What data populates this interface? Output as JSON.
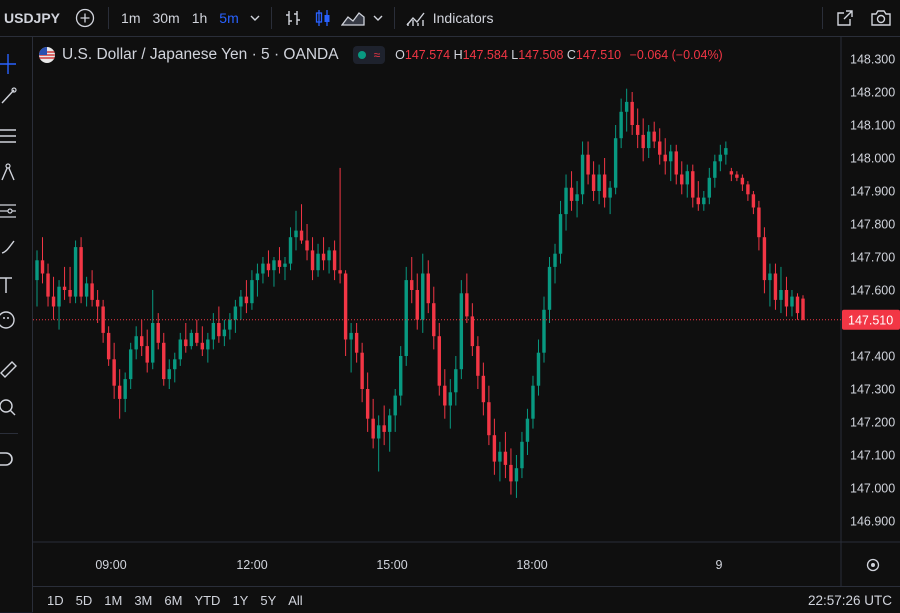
{
  "toolbar": {
    "symbol": "USDJPY",
    "timeframes": [
      "1m",
      "30m",
      "1h",
      "5m"
    ],
    "active_timeframe": "5m",
    "indicators_label": "Indicators"
  },
  "legend": {
    "title": "U.S. Dollar / Japanese Yen · 5 · OANDA",
    "open_label": "O",
    "open": "147.574",
    "high_label": "H",
    "high": "147.584",
    "low_label": "L",
    "low": "147.508",
    "close_label": "C",
    "close": "147.510",
    "change": "−0.064 (−0.04%)"
  },
  "bottom": {
    "ranges": [
      "1D",
      "5D",
      "1M",
      "3M",
      "6M",
      "YTD",
      "1Y",
      "5Y",
      "All"
    ],
    "clock": "22:57:26 UTC"
  },
  "colors": {
    "up": "#089981",
    "down": "#f23645",
    "accent": "#2962ff"
  },
  "chart_data": {
    "type": "candlestick",
    "y_ticks": [
      "148.300",
      "148.200",
      "148.100",
      "148.000",
      "147.900",
      "147.800",
      "147.700",
      "147.600",
      "147.510",
      "147.400",
      "147.300",
      "147.200",
      "147.100",
      "147.000",
      "146.900"
    ],
    "x_ticks": [
      "09:00",
      "12:00",
      "15:00",
      "18:00",
      "9"
    ],
    "ylim": [
      146.87,
      148.33
    ],
    "last_price": "147.510",
    "candles": [
      {
        "o": 147.63,
        "h": 147.72,
        "l": 147.55,
        "c": 147.69
      },
      {
        "o": 147.69,
        "h": 147.76,
        "l": 147.62,
        "c": 147.65
      },
      {
        "o": 147.65,
        "h": 147.68,
        "l": 147.55,
        "c": 147.58
      },
      {
        "o": 147.58,
        "h": 147.64,
        "l": 147.51,
        "c": 147.55
      },
      {
        "o": 147.55,
        "h": 147.63,
        "l": 147.48,
        "c": 147.61
      },
      {
        "o": 147.61,
        "h": 147.67,
        "l": 147.57,
        "c": 147.6
      },
      {
        "o": 147.6,
        "h": 147.67,
        "l": 147.56,
        "c": 147.58
      },
      {
        "o": 147.58,
        "h": 147.75,
        "l": 147.56,
        "c": 147.73
      },
      {
        "o": 147.73,
        "h": 147.76,
        "l": 147.56,
        "c": 147.58
      },
      {
        "o": 147.58,
        "h": 147.64,
        "l": 147.55,
        "c": 147.62
      },
      {
        "o": 147.62,
        "h": 147.66,
        "l": 147.55,
        "c": 147.57
      },
      {
        "o": 147.57,
        "h": 147.6,
        "l": 147.5,
        "c": 147.55
      },
      {
        "o": 147.55,
        "h": 147.57,
        "l": 147.44,
        "c": 147.47
      },
      {
        "o": 147.47,
        "h": 147.49,
        "l": 147.37,
        "c": 147.39
      },
      {
        "o": 147.39,
        "h": 147.44,
        "l": 147.27,
        "c": 147.31
      },
      {
        "o": 147.31,
        "h": 147.36,
        "l": 147.21,
        "c": 147.27
      },
      {
        "o": 147.27,
        "h": 147.35,
        "l": 147.23,
        "c": 147.33
      },
      {
        "o": 147.33,
        "h": 147.44,
        "l": 147.3,
        "c": 147.42
      },
      {
        "o": 147.42,
        "h": 147.49,
        "l": 147.39,
        "c": 147.46
      },
      {
        "o": 147.46,
        "h": 147.51,
        "l": 147.4,
        "c": 147.43
      },
      {
        "o": 147.43,
        "h": 147.48,
        "l": 147.35,
        "c": 147.38
      },
      {
        "o": 147.38,
        "h": 147.6,
        "l": 147.36,
        "c": 147.5
      },
      {
        "o": 147.5,
        "h": 147.53,
        "l": 147.42,
        "c": 147.44
      },
      {
        "o": 147.44,
        "h": 147.47,
        "l": 147.31,
        "c": 147.33
      },
      {
        "o": 147.33,
        "h": 147.39,
        "l": 147.3,
        "c": 147.36
      },
      {
        "o": 147.36,
        "h": 147.41,
        "l": 147.32,
        "c": 147.39
      },
      {
        "o": 147.39,
        "h": 147.47,
        "l": 147.37,
        "c": 147.45
      },
      {
        "o": 147.45,
        "h": 147.5,
        "l": 147.41,
        "c": 147.43
      },
      {
        "o": 147.43,
        "h": 147.48,
        "l": 147.42,
        "c": 147.47
      },
      {
        "o": 147.47,
        "h": 147.51,
        "l": 147.43,
        "c": 147.44
      },
      {
        "o": 147.44,
        "h": 147.49,
        "l": 147.4,
        "c": 147.42
      },
      {
        "o": 147.42,
        "h": 147.47,
        "l": 147.38,
        "c": 147.45
      },
      {
        "o": 147.45,
        "h": 147.53,
        "l": 147.42,
        "c": 147.5
      },
      {
        "o": 147.5,
        "h": 147.55,
        "l": 147.44,
        "c": 147.46
      },
      {
        "o": 147.46,
        "h": 147.51,
        "l": 147.43,
        "c": 147.48
      },
      {
        "o": 147.48,
        "h": 147.53,
        "l": 147.45,
        "c": 147.51
      },
      {
        "o": 147.51,
        "h": 147.57,
        "l": 147.47,
        "c": 147.55
      },
      {
        "o": 147.55,
        "h": 147.6,
        "l": 147.51,
        "c": 147.58
      },
      {
        "o": 147.58,
        "h": 147.63,
        "l": 147.53,
        "c": 147.56
      },
      {
        "o": 147.56,
        "h": 147.66,
        "l": 147.54,
        "c": 147.63
      },
      {
        "o": 147.63,
        "h": 147.68,
        "l": 147.58,
        "c": 147.65
      },
      {
        "o": 147.65,
        "h": 147.7,
        "l": 147.62,
        "c": 147.68
      },
      {
        "o": 147.68,
        "h": 147.72,
        "l": 147.64,
        "c": 147.66
      },
      {
        "o": 147.66,
        "h": 147.7,
        "l": 147.61,
        "c": 147.69
      },
      {
        "o": 147.69,
        "h": 147.73,
        "l": 147.65,
        "c": 147.67
      },
      {
        "o": 147.67,
        "h": 147.7,
        "l": 147.63,
        "c": 147.68
      },
      {
        "o": 147.68,
        "h": 147.79,
        "l": 147.66,
        "c": 147.76
      },
      {
        "o": 147.76,
        "h": 147.84,
        "l": 147.72,
        "c": 147.78
      },
      {
        "o": 147.78,
        "h": 147.86,
        "l": 147.74,
        "c": 147.75
      },
      {
        "o": 147.75,
        "h": 147.8,
        "l": 147.69,
        "c": 147.72
      },
      {
        "o": 147.72,
        "h": 147.76,
        "l": 147.63,
        "c": 147.66
      },
      {
        "o": 147.66,
        "h": 147.74,
        "l": 147.64,
        "c": 147.71
      },
      {
        "o": 147.71,
        "h": 147.76,
        "l": 147.66,
        "c": 147.69
      },
      {
        "o": 147.69,
        "h": 147.73,
        "l": 147.65,
        "c": 147.72
      },
      {
        "o": 147.72,
        "h": 147.75,
        "l": 147.63,
        "c": 147.66
      },
      {
        "o": 147.66,
        "h": 147.97,
        "l": 147.62,
        "c": 147.65
      },
      {
        "o": 147.65,
        "h": 147.66,
        "l": 147.4,
        "c": 147.45
      },
      {
        "o": 147.45,
        "h": 147.5,
        "l": 147.35,
        "c": 147.47
      },
      {
        "o": 147.47,
        "h": 147.5,
        "l": 147.38,
        "c": 147.41
      },
      {
        "o": 147.41,
        "h": 147.44,
        "l": 147.26,
        "c": 147.3
      },
      {
        "o": 147.3,
        "h": 147.35,
        "l": 147.17,
        "c": 147.21
      },
      {
        "o": 147.21,
        "h": 147.27,
        "l": 147.12,
        "c": 147.15
      },
      {
        "o": 147.15,
        "h": 147.22,
        "l": 147.05,
        "c": 147.19
      },
      {
        "o": 147.19,
        "h": 147.25,
        "l": 147.13,
        "c": 147.17
      },
      {
        "o": 147.17,
        "h": 147.24,
        "l": 147.11,
        "c": 147.22
      },
      {
        "o": 147.22,
        "h": 147.3,
        "l": 147.17,
        "c": 147.28
      },
      {
        "o": 147.28,
        "h": 147.43,
        "l": 147.25,
        "c": 147.4
      },
      {
        "o": 147.4,
        "h": 147.67,
        "l": 147.37,
        "c": 147.63
      },
      {
        "o": 147.63,
        "h": 147.7,
        "l": 147.56,
        "c": 147.6
      },
      {
        "o": 147.6,
        "h": 147.65,
        "l": 147.48,
        "c": 147.51
      },
      {
        "o": 147.51,
        "h": 147.71,
        "l": 147.47,
        "c": 147.65
      },
      {
        "o": 147.65,
        "h": 147.69,
        "l": 147.53,
        "c": 147.56
      },
      {
        "o": 147.56,
        "h": 147.61,
        "l": 147.42,
        "c": 147.46
      },
      {
        "o": 147.46,
        "h": 147.5,
        "l": 147.28,
        "c": 147.31
      },
      {
        "o": 147.31,
        "h": 147.36,
        "l": 147.21,
        "c": 147.25
      },
      {
        "o": 147.25,
        "h": 147.33,
        "l": 147.18,
        "c": 147.29
      },
      {
        "o": 147.29,
        "h": 147.4,
        "l": 147.25,
        "c": 147.36
      },
      {
        "o": 147.36,
        "h": 147.63,
        "l": 147.33,
        "c": 147.59
      },
      {
        "o": 147.59,
        "h": 147.65,
        "l": 147.5,
        "c": 147.52
      },
      {
        "o": 147.52,
        "h": 147.56,
        "l": 147.4,
        "c": 147.43
      },
      {
        "o": 147.43,
        "h": 147.46,
        "l": 147.3,
        "c": 147.34
      },
      {
        "o": 147.34,
        "h": 147.38,
        "l": 147.22,
        "c": 147.26
      },
      {
        "o": 147.26,
        "h": 147.31,
        "l": 147.13,
        "c": 147.16
      },
      {
        "o": 147.16,
        "h": 147.21,
        "l": 147.04,
        "c": 147.08
      },
      {
        "o": 147.08,
        "h": 147.14,
        "l": 147.02,
        "c": 147.11
      },
      {
        "o": 147.11,
        "h": 147.17,
        "l": 147.03,
        "c": 147.07
      },
      {
        "o": 147.07,
        "h": 147.12,
        "l": 146.98,
        "c": 147.02
      },
      {
        "o": 147.02,
        "h": 147.1,
        "l": 146.97,
        "c": 147.06
      },
      {
        "o": 147.06,
        "h": 147.17,
        "l": 147.03,
        "c": 147.14
      },
      {
        "o": 147.14,
        "h": 147.24,
        "l": 147.1,
        "c": 147.21
      },
      {
        "o": 147.21,
        "h": 147.34,
        "l": 147.18,
        "c": 147.31
      },
      {
        "o": 147.31,
        "h": 147.45,
        "l": 147.28,
        "c": 147.41
      },
      {
        "o": 147.41,
        "h": 147.58,
        "l": 147.38,
        "c": 147.54
      },
      {
        "o": 147.54,
        "h": 147.7,
        "l": 147.5,
        "c": 147.67
      },
      {
        "o": 147.67,
        "h": 147.74,
        "l": 147.62,
        "c": 147.71
      },
      {
        "o": 147.71,
        "h": 147.87,
        "l": 147.68,
        "c": 147.83
      },
      {
        "o": 147.83,
        "h": 147.95,
        "l": 147.78,
        "c": 147.91
      },
      {
        "o": 147.91,
        "h": 147.96,
        "l": 147.84,
        "c": 147.87
      },
      {
        "o": 147.87,
        "h": 147.93,
        "l": 147.82,
        "c": 147.89
      },
      {
        "o": 147.89,
        "h": 148.05,
        "l": 147.86,
        "c": 148.01
      },
      {
        "o": 148.01,
        "h": 148.05,
        "l": 147.92,
        "c": 147.95
      },
      {
        "o": 147.95,
        "h": 147.99,
        "l": 147.87,
        "c": 147.9
      },
      {
        "o": 147.9,
        "h": 147.98,
        "l": 147.86,
        "c": 147.95
      },
      {
        "o": 147.95,
        "h": 148.0,
        "l": 147.85,
        "c": 147.88
      },
      {
        "o": 147.88,
        "h": 147.93,
        "l": 147.83,
        "c": 147.91
      },
      {
        "o": 147.91,
        "h": 148.1,
        "l": 147.89,
        "c": 148.06
      },
      {
        "o": 148.06,
        "h": 148.18,
        "l": 148.03,
        "c": 148.14
      },
      {
        "o": 148.14,
        "h": 148.21,
        "l": 148.08,
        "c": 148.17
      },
      {
        "o": 148.17,
        "h": 148.2,
        "l": 148.07,
        "c": 148.1
      },
      {
        "o": 148.1,
        "h": 148.15,
        "l": 148.03,
        "c": 148.07
      },
      {
        "o": 148.07,
        "h": 148.12,
        "l": 147.99,
        "c": 148.03
      },
      {
        "o": 148.03,
        "h": 148.1,
        "l": 148.0,
        "c": 148.08
      },
      {
        "o": 148.08,
        "h": 148.11,
        "l": 148.03,
        "c": 148.05
      },
      {
        "o": 148.05,
        "h": 148.09,
        "l": 147.98,
        "c": 148.01
      },
      {
        "o": 148.01,
        "h": 148.06,
        "l": 147.95,
        "c": 147.99
      },
      {
        "o": 147.99,
        "h": 148.04,
        "l": 147.93,
        "c": 148.02
      },
      {
        "o": 148.02,
        "h": 148.04,
        "l": 147.92,
        "c": 147.95
      },
      {
        "o": 147.95,
        "h": 147.99,
        "l": 147.89,
        "c": 147.92
      },
      {
        "o": 147.92,
        "h": 147.98,
        "l": 147.88,
        "c": 147.96
      },
      {
        "o": 147.96,
        "h": 147.98,
        "l": 147.85,
        "c": 147.88
      },
      {
        "o": 147.88,
        "h": 147.93,
        "l": 147.84,
        "c": 147.86
      },
      {
        "o": 147.86,
        "h": 147.9,
        "l": 147.84,
        "c": 147.88
      },
      {
        "o": 147.88,
        "h": 147.97,
        "l": 147.86,
        "c": 147.94
      },
      {
        "o": 147.94,
        "h": 148.01,
        "l": 147.91,
        "c": 147.99
      },
      {
        "o": 147.99,
        "h": 148.04,
        "l": 147.96,
        "c": 148.01
      },
      {
        "o": 148.01,
        "h": 148.05,
        "l": 147.98,
        "c": 148.03
      },
      {
        "o": 147.96,
        "h": 147.97,
        "l": 147.93,
        "c": 147.95
      },
      {
        "o": 147.95,
        "h": 147.96,
        "l": 147.93,
        "c": 147.94
      },
      {
        "o": 147.94,
        "h": 147.95,
        "l": 147.9,
        "c": 147.92
      },
      {
        "o": 147.92,
        "h": 147.93,
        "l": 147.87,
        "c": 147.89
      },
      {
        "o": 147.89,
        "h": 147.9,
        "l": 147.83,
        "c": 147.85
      },
      {
        "o": 147.85,
        "h": 147.87,
        "l": 147.72,
        "c": 147.76
      },
      {
        "o": 147.76,
        "h": 147.79,
        "l": 147.59,
        "c": 147.63
      },
      {
        "o": 147.63,
        "h": 147.68,
        "l": 147.55,
        "c": 147.65
      },
      {
        "o": 147.65,
        "h": 147.68,
        "l": 147.54,
        "c": 147.57
      },
      {
        "o": 147.57,
        "h": 147.67,
        "l": 147.53,
        "c": 147.6
      },
      {
        "o": 147.6,
        "h": 147.64,
        "l": 147.52,
        "c": 147.55
      },
      {
        "o": 147.55,
        "h": 147.6,
        "l": 147.52,
        "c": 147.58
      },
      {
        "o": 147.58,
        "h": 147.59,
        "l": 147.51,
        "c": 147.53
      },
      {
        "o": 147.574,
        "h": 147.584,
        "l": 147.508,
        "c": 147.51
      }
    ]
  }
}
